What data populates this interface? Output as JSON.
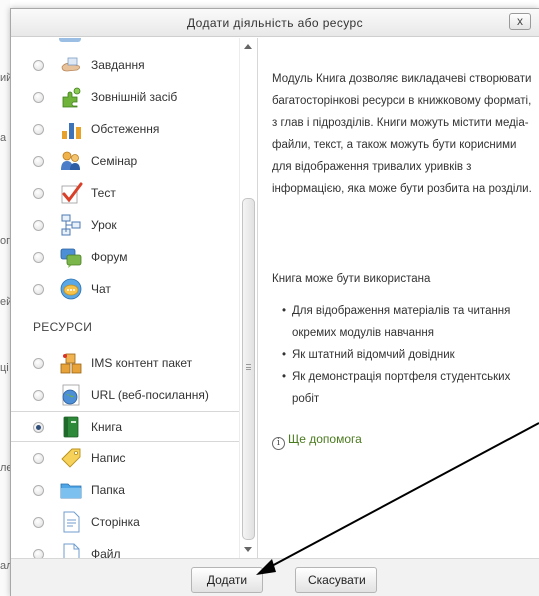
{
  "background": {
    "fragments": [
      "ий",
      "а",
      "ог",
      "ей",
      "ці",
      "ле",
      "ал"
    ]
  },
  "dialog": {
    "title": "Додати діяльність або ресурс",
    "close_label": "x"
  },
  "activities": [
    {
      "label": "Завдання",
      "icon": "assignment-icon"
    },
    {
      "label": "Зовнішній засіб",
      "icon": "external-tool-icon"
    },
    {
      "label": "Обстеження",
      "icon": "survey-icon"
    },
    {
      "label": "Семінар",
      "icon": "workshop-icon"
    },
    {
      "label": "Тест",
      "icon": "quiz-icon"
    },
    {
      "label": "Урок",
      "icon": "lesson-icon"
    },
    {
      "label": "Форум",
      "icon": "forum-icon"
    },
    {
      "label": "Чат",
      "icon": "chat-icon"
    }
  ],
  "resources_header": "РЕСУРСИ",
  "resources": [
    {
      "label": "IMS контент пакет",
      "icon": "ims-package-icon",
      "selected": false
    },
    {
      "label": "URL (веб-посилання)",
      "icon": "url-icon",
      "selected": false
    },
    {
      "label": "Книга",
      "icon": "book-icon",
      "selected": true
    },
    {
      "label": "Напис",
      "icon": "label-tag-icon",
      "selected": false
    },
    {
      "label": "Папка",
      "icon": "folder-icon",
      "selected": false
    },
    {
      "label": "Сторінка",
      "icon": "page-icon",
      "selected": false
    },
    {
      "label": "Файл",
      "icon": "file-icon",
      "selected": false
    }
  ],
  "help": {
    "paragraph1": "Модуль Книга дозволяє викладачеві створювати багатосторінкові ресурси в книжковому форматі, з глав і підрозділів. Книги можуть містити медіа-файли, текст, а також можуть бути корисними для відображення тривалих уривків з інформацією, яка може бути розбита на розділи.",
    "paragraph2": "Книга може бути використана",
    "bullets": [
      "Для відображення матеріалів та читання окремих модулів навчання",
      "Як штатний відомчий довідник",
      "Як демонстрація портфеля студентських робіт"
    ],
    "more_help": "Ще допомога",
    "info_glyph": "i"
  },
  "footer": {
    "add_label": "Додати",
    "cancel_label": "Скасувати"
  },
  "colors": {
    "link_green": "#4a7a1e",
    "radio_checked": "#2f4f7a",
    "annotation_arrow": "#000000"
  }
}
